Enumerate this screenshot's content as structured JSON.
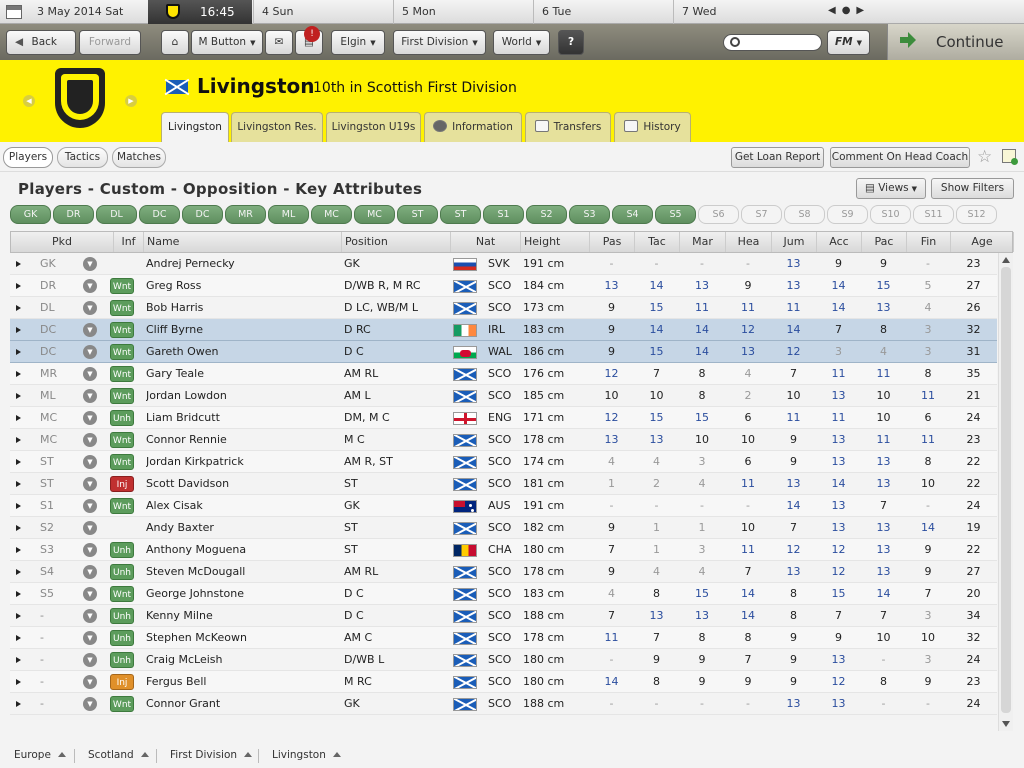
{
  "calendar": {
    "date": "3 May 2014  Sat",
    "time": "16:45",
    "days": [
      "4  Sun",
      "5  Mon",
      "6  Tue",
      "7  Wed"
    ]
  },
  "toolbar": {
    "back": "Back",
    "forward": "Forward",
    "m_button": "M Button",
    "elgin": "Elgin",
    "division": "First Division",
    "world": "World",
    "help": "?",
    "fm": "FM",
    "continue": "Continue",
    "search_placeholder": ""
  },
  "club": {
    "name": "Livingston",
    "subtitle": "10th in Scottish First Division"
  },
  "tabs": [
    {
      "label": "Livingston"
    },
    {
      "label": "Livingston Res."
    },
    {
      "label": "Livingston U19s"
    },
    {
      "label": "Information"
    },
    {
      "label": "Transfers"
    },
    {
      "label": "History"
    }
  ],
  "subtabs": [
    "Players",
    "Tactics",
    "Matches"
  ],
  "actions": {
    "loan": "Get Loan Report",
    "comment": "Comment On Head Coach",
    "views": "Views",
    "filters": "Show Filters"
  },
  "view_title": "Players - Custom - Opposition - Key Attributes",
  "pills": [
    {
      "label": "GK",
      "on": true
    },
    {
      "label": "DR",
      "on": true
    },
    {
      "label": "DL",
      "on": true
    },
    {
      "label": "DC",
      "on": true
    },
    {
      "label": "DC",
      "on": true
    },
    {
      "label": "MR",
      "on": true
    },
    {
      "label": "ML",
      "on": true
    },
    {
      "label": "MC",
      "on": true
    },
    {
      "label": "MC",
      "on": true
    },
    {
      "label": "ST",
      "on": true
    },
    {
      "label": "ST",
      "on": true
    },
    {
      "label": "S1",
      "on": true
    },
    {
      "label": "S2",
      "on": true
    },
    {
      "label": "S3",
      "on": true
    },
    {
      "label": "S4",
      "on": true
    },
    {
      "label": "S5",
      "on": true
    },
    {
      "label": "S6",
      "on": false
    },
    {
      "label": "S7",
      "on": false
    },
    {
      "label": "S8",
      "on": false
    },
    {
      "label": "S9",
      "on": false
    },
    {
      "label": "S10",
      "on": false
    },
    {
      "label": "S11",
      "on": false
    },
    {
      "label": "S12",
      "on": false
    }
  ],
  "columns": [
    "Pkd",
    "Inf",
    "Name",
    "Position",
    "Nat",
    "Height",
    "Pas",
    "Tac",
    "Mar",
    "Hea",
    "Jum",
    "Acc",
    "Pac",
    "Fin",
    "Age"
  ],
  "players": [
    {
      "pkd": "GK",
      "inf": "",
      "name": "Andrej Pernecky",
      "pos": "GK",
      "nat": "SVK",
      "flag": "svk",
      "height": "191 cm",
      "attrs": [
        "-",
        "-",
        "-",
        "-",
        "13",
        "9",
        "9",
        "-"
      ],
      "age": "23"
    },
    {
      "pkd": "DR",
      "inf": "Wnt",
      "name": "Greg Ross",
      "pos": "D/WB R, M RC",
      "nat": "SCO",
      "flag": "sco",
      "height": "184 cm",
      "attrs": [
        "13",
        "14",
        "13",
        "9",
        "13",
        "14",
        "15",
        "5"
      ],
      "age": "27"
    },
    {
      "pkd": "DL",
      "inf": "Wnt",
      "name": "Bob Harris",
      "pos": "D LC, WB/M L",
      "nat": "SCO",
      "flag": "sco",
      "height": "173 cm",
      "attrs": [
        "9",
        "15",
        "11",
        "11",
        "11",
        "14",
        "13",
        "4"
      ],
      "age": "26"
    },
    {
      "pkd": "DC",
      "inf": "Wnt",
      "name": "Cliff Byrne",
      "pos": "D RC",
      "nat": "IRL",
      "flag": "irl",
      "height": "183 cm",
      "attrs": [
        "9",
        "14",
        "14",
        "12",
        "14",
        "7",
        "8",
        "3"
      ],
      "age": "32",
      "sel": true
    },
    {
      "pkd": "DC",
      "inf": "Wnt",
      "name": "Gareth Owen",
      "pos": "D C",
      "nat": "WAL",
      "flag": "wal",
      "height": "186 cm",
      "attrs": [
        "9",
        "15",
        "14",
        "13",
        "12",
        "3",
        "4",
        "3"
      ],
      "age": "31",
      "sel": true
    },
    {
      "pkd": "MR",
      "inf": "Wnt",
      "name": "Gary Teale",
      "pos": "AM RL",
      "nat": "SCO",
      "flag": "sco",
      "height": "176 cm",
      "attrs": [
        "12",
        "7",
        "8",
        "4",
        "7",
        "11",
        "11",
        "8"
      ],
      "age": "35"
    },
    {
      "pkd": "ML",
      "inf": "Wnt",
      "name": "Jordan Lowdon",
      "pos": "AM L",
      "nat": "SCO",
      "flag": "sco",
      "height": "185 cm",
      "attrs": [
        "10",
        "10",
        "8",
        "2",
        "10",
        "13",
        "10",
        "11"
      ],
      "age": "21"
    },
    {
      "pkd": "MC",
      "inf": "Unh",
      "name": "Liam Bridcutt",
      "pos": "DM, M C",
      "nat": "ENG",
      "flag": "eng",
      "height": "171 cm",
      "attrs": [
        "12",
        "15",
        "15",
        "6",
        "11",
        "11",
        "10",
        "6"
      ],
      "age": "24"
    },
    {
      "pkd": "MC",
      "inf": "Wnt",
      "name": "Connor Rennie",
      "pos": "M C",
      "nat": "SCO",
      "flag": "sco",
      "height": "178 cm",
      "attrs": [
        "13",
        "13",
        "10",
        "10",
        "9",
        "13",
        "11",
        "11"
      ],
      "age": "23"
    },
    {
      "pkd": "ST",
      "inf": "Wnt",
      "name": "Jordan Kirkpatrick",
      "pos": "AM R, ST",
      "nat": "SCO",
      "flag": "sco",
      "height": "174 cm",
      "attrs": [
        "4",
        "4",
        "3",
        "6",
        "9",
        "13",
        "13",
        "8"
      ],
      "age": "22"
    },
    {
      "pkd": "ST",
      "inf": "Inj",
      "name": "Scott Davidson",
      "pos": "ST",
      "nat": "SCO",
      "flag": "sco",
      "height": "181 cm",
      "attrs": [
        "1",
        "2",
        "4",
        "11",
        "13",
        "14",
        "13",
        "10"
      ],
      "age": "22"
    },
    {
      "pkd": "S1",
      "inf": "Wnt",
      "name": "Alex Cisak",
      "pos": "GK",
      "nat": "AUS",
      "flag": "aus",
      "height": "191 cm",
      "attrs": [
        "-",
        "-",
        "-",
        "-",
        "14",
        "13",
        "7",
        "-"
      ],
      "age": "24"
    },
    {
      "pkd": "S2",
      "inf": "",
      "name": "Andy Baxter",
      "pos": "ST",
      "nat": "SCO",
      "flag": "sco",
      "height": "182 cm",
      "attrs": [
        "9",
        "1",
        "1",
        "10",
        "7",
        "13",
        "13",
        "14"
      ],
      "age": "19"
    },
    {
      "pkd": "S3",
      "inf": "Unh",
      "name": "Anthony Moguena",
      "pos": "ST",
      "nat": "CHA",
      "flag": "cha",
      "height": "180 cm",
      "attrs": [
        "7",
        "1",
        "3",
        "11",
        "12",
        "12",
        "13",
        "9"
      ],
      "age": "22"
    },
    {
      "pkd": "S4",
      "inf": "Unh",
      "name": "Steven McDougall",
      "pos": "AM RL",
      "nat": "SCO",
      "flag": "sco",
      "height": "178 cm",
      "attrs": [
        "9",
        "4",
        "4",
        "7",
        "13",
        "12",
        "13",
        "9"
      ],
      "age": "27"
    },
    {
      "pkd": "S5",
      "inf": "Wnt",
      "name": "George Johnstone",
      "pos": "D C",
      "nat": "SCO",
      "flag": "sco",
      "height": "183 cm",
      "attrs": [
        "4",
        "8",
        "15",
        "14",
        "8",
        "15",
        "14",
        "7"
      ],
      "age": "20"
    },
    {
      "pkd": "-",
      "inf": "Unh",
      "name": "Kenny Milne",
      "pos": "D C",
      "nat": "SCO",
      "flag": "sco",
      "height": "188 cm",
      "attrs": [
        "7",
        "13",
        "13",
        "14",
        "8",
        "7",
        "7",
        "3"
      ],
      "age": "34"
    },
    {
      "pkd": "-",
      "inf": "Unh",
      "name": "Stephen McKeown",
      "pos": "AM C",
      "nat": "SCO",
      "flag": "sco",
      "height": "178 cm",
      "attrs": [
        "11",
        "7",
        "8",
        "8",
        "9",
        "9",
        "10",
        "10"
      ],
      "age": "32"
    },
    {
      "pkd": "-",
      "inf": "Unh",
      "name": "Craig McLeish",
      "pos": "D/WB L",
      "nat": "SCO",
      "flag": "sco",
      "height": "180 cm",
      "attrs": [
        "-",
        "9",
        "9",
        "7",
        "9",
        "13",
        "-",
        "3"
      ],
      "age": "24"
    },
    {
      "pkd": "-",
      "inf": "InjO",
      "name": "Fergus Bell",
      "pos": "M RC",
      "nat": "SCO",
      "flag": "sco",
      "height": "180 cm",
      "attrs": [
        "14",
        "8",
        "9",
        "9",
        "9",
        "12",
        "8",
        "9"
      ],
      "age": "23"
    },
    {
      "pkd": "-",
      "inf": "Wnt",
      "name": "Connor Grant",
      "pos": "GK",
      "nat": "SCO",
      "flag": "sco",
      "height": "188 cm",
      "attrs": [
        "-",
        "-",
        "-",
        "-",
        "13",
        "13",
        "-",
        "-"
      ],
      "age": "24"
    }
  ],
  "breadcrumbs": [
    "Europe",
    "Scotland",
    "First Division",
    "Livingston"
  ],
  "colors": {
    "header": "#fff200",
    "attr_high": "#2a4d9e",
    "attr_low": "#999999",
    "selected_row": "#c6d6e6"
  }
}
